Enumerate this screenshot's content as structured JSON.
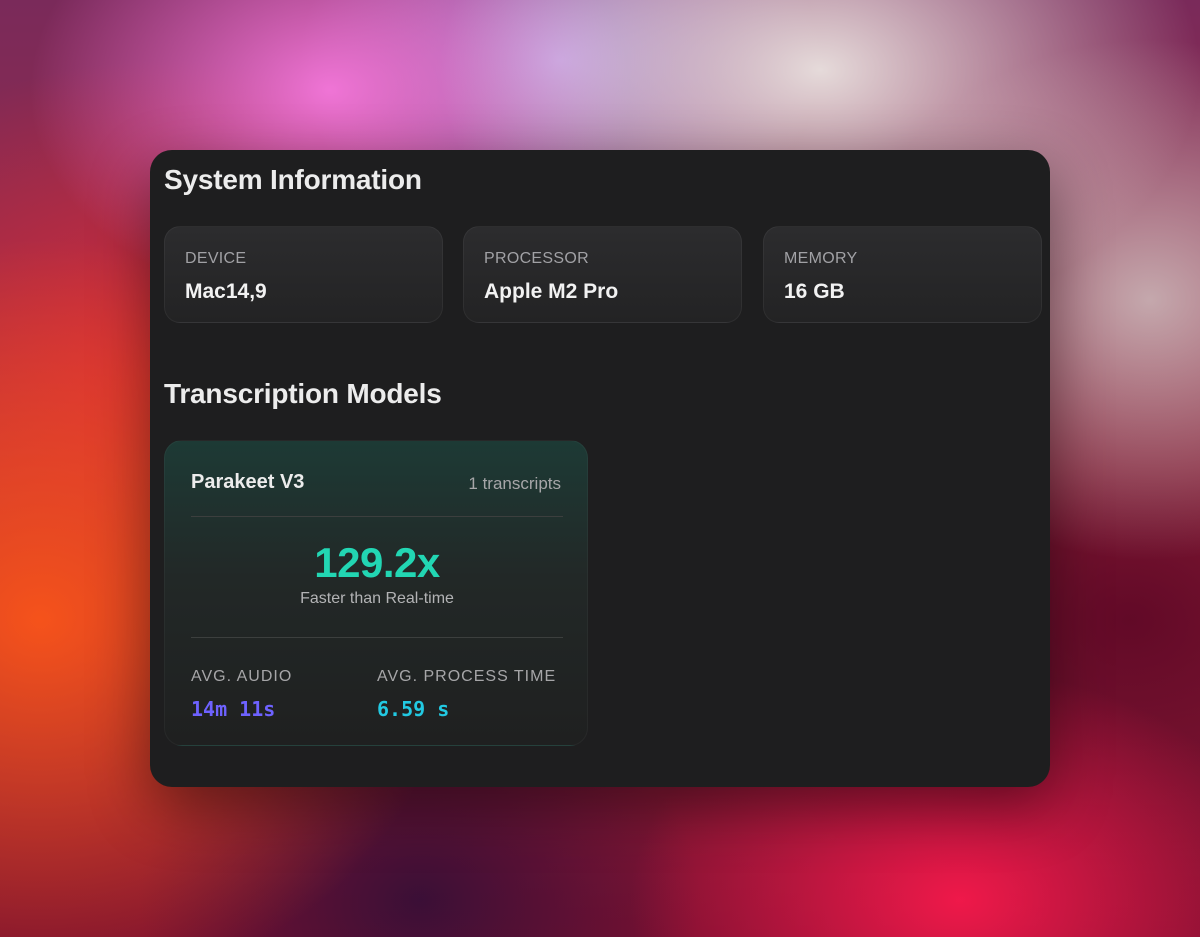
{
  "system": {
    "title": "System Information",
    "cards": [
      {
        "label": "DEVICE",
        "value": "Mac14,9"
      },
      {
        "label": "PROCESSOR",
        "value": "Apple M2 Pro"
      },
      {
        "label": "MEMORY",
        "value": "16 GB"
      }
    ]
  },
  "models": {
    "title": "Transcription Models",
    "items": [
      {
        "name": "Parakeet V3",
        "count": "1 transcripts",
        "speed": "129.2x",
        "speed_caption": "Faster than Real-time",
        "avg_audio_label": "AVG. AUDIO",
        "avg_audio_value": "14m 11s",
        "avg_process_label": "AVG. PROCESS TIME",
        "avg_process_value": "6.59 s"
      }
    ]
  },
  "colors": {
    "speed": "#22d6b3",
    "avg_audio": "#6e62ff",
    "avg_process": "#22c9e2",
    "panel_bg": "#1e1e1f"
  }
}
